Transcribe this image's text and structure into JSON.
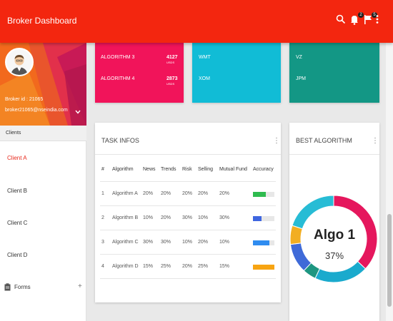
{
  "header": {
    "title": "Broker Dashboard",
    "notifications_count": "2",
    "flags_count": "5"
  },
  "sidebar": {
    "broker_id": "Broker id : 21065",
    "broker_email": "broker21065@nseindia.com",
    "clients_header": "Clients",
    "clients": [
      "Client A",
      "Client B",
      "Client C",
      "Client D"
    ],
    "active_client": "Client A",
    "forms_label": "Forms",
    "forms_plus": "+"
  },
  "top_cards": {
    "algos": [
      {
        "name": "ALGORITHM 3",
        "count": "4127",
        "unit": "USDS"
      },
      {
        "name": "ALGORITHM 4",
        "count": "2873",
        "unit": "USDS"
      }
    ],
    "cyan_stocks": [
      "WMT",
      "XOM"
    ],
    "teal_stocks": [
      "VZ",
      "JPM"
    ]
  },
  "task_infos": {
    "title": "TASK INFOS",
    "menu": "⋮",
    "columns": [
      "#",
      "Algorithm",
      "News",
      "Trends",
      "Risk",
      "Selling",
      "Mutual Fund",
      "Accuracy"
    ],
    "rows": [
      {
        "num": "1",
        "algorithm": "Algorithm A",
        "news": "20%",
        "trends": "20%",
        "risk": "20%",
        "selling": "20%",
        "mutual": "20%",
        "accuracy": 0.6,
        "color": "#2fbb4f"
      },
      {
        "num": "2",
        "algorithm": "Algorithm B",
        "news": "10%",
        "trends": "20%",
        "risk": "30%",
        "selling": "10%",
        "mutual": "30%",
        "accuracy": 0.4,
        "color": "#3f66e0"
      },
      {
        "num": "3",
        "algorithm": "Algorithm C",
        "news": "30%",
        "trends": "30%",
        "risk": "10%",
        "selling": "20%",
        "mutual": "10%",
        "accuracy": 0.75,
        "color": "#2f8cf0"
      },
      {
        "num": "4",
        "algorithm": "Algorithm D",
        "news": "15%",
        "trends": "25%",
        "risk": "20%",
        "selling": "25%",
        "mutual": "15%",
        "accuracy": 1.0,
        "color": "#f7a412"
      }
    ]
  },
  "best_algorithm": {
    "title": "BEST ALGORITHM",
    "menu": "⋮",
    "name": "Algo 1",
    "value": "37%",
    "segments": [
      {
        "share": 0.37,
        "color": "#e5175d"
      },
      {
        "share": 0.2,
        "color": "#1aaacd"
      },
      {
        "share": 0.05,
        "color": "#1d9681"
      },
      {
        "share": 0.11,
        "color": "#3f6ad8"
      },
      {
        "share": 0.07,
        "color": "#f2ae22"
      },
      {
        "share": 0.2,
        "color": "#27bcd5"
      }
    ]
  },
  "colors": {
    "header": "#f3260f",
    "accent_active": "#e8291c",
    "pink_card": "#f1145a",
    "cyan_card": "#11bcd6",
    "teal_card": "#139785"
  }
}
